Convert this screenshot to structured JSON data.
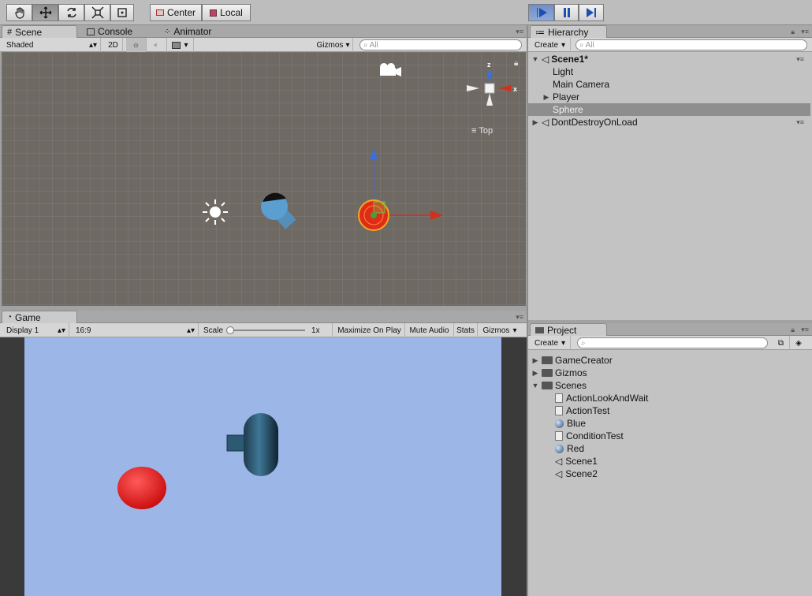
{
  "toolbar": {
    "tools": [
      "hand-icon",
      "move-icon",
      "rotate-icon",
      "scale-icon",
      "rect-icon"
    ],
    "pivot_center": "Center",
    "pivot_local": "Local",
    "play": [
      "play-icon",
      "pause-icon",
      "step-icon"
    ]
  },
  "scene_panel": {
    "tabs": [
      {
        "label": "Scene",
        "icon": "grid-icon"
      },
      {
        "label": "Console",
        "icon": "console-icon"
      },
      {
        "label": "Animator",
        "icon": "animator-icon"
      }
    ],
    "shading_mode": "Shaded",
    "mode_2d": "2D",
    "gizmos": "Gizmos",
    "search_placeholder": "All",
    "orientation": "Top",
    "axis_x": "x",
    "axis_z": "z"
  },
  "game_panel": {
    "tab": "Game",
    "display": "Display 1",
    "aspect": "16:9",
    "scale_label": "Scale",
    "scale_value": "1x",
    "maximize_on_play": "Maximize On Play",
    "mute_audio": "Mute Audio",
    "stats": "Stats",
    "gizmos": "Gizmos"
  },
  "hierarchy": {
    "tab": "Hierarchy",
    "create": "Create",
    "search_placeholder": "All",
    "scene_name": "Scene1*",
    "items": [
      "Light",
      "Main Camera",
      "Player",
      "Sphere"
    ],
    "selected": "Sphere",
    "dont_destroy": "DontDestroyOnLoad"
  },
  "project": {
    "tab": "Project",
    "create": "Create",
    "folders": [
      "GameCreator",
      "Gizmos",
      "Scenes"
    ],
    "files": [
      {
        "name": "ActionLookAndWait",
        "type": "file"
      },
      {
        "name": "ActionTest",
        "type": "file"
      },
      {
        "name": "Blue",
        "type": "material"
      },
      {
        "name": "ConditionTest",
        "type": "file"
      },
      {
        "name": "Red",
        "type": "material"
      },
      {
        "name": "Scene1",
        "type": "scene"
      },
      {
        "name": "Scene2",
        "type": "scene"
      }
    ]
  },
  "colors": {
    "toolbar_bg": "#bdbdbd",
    "scene_bg": "#6f6964",
    "game_sky": "#9cb6e7",
    "selection": "#8e8e8e",
    "play_active": "#6f8fc8"
  }
}
